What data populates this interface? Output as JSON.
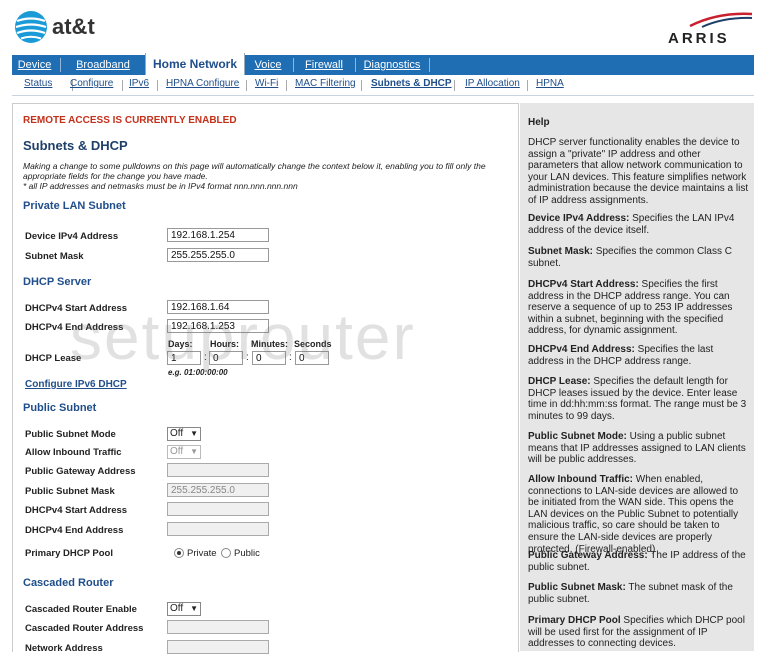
{
  "brand": {
    "att": "at&t",
    "arris": "ARRIS"
  },
  "nav": {
    "tabs": [
      "Device",
      "Broadband",
      "Home Network",
      "Voice",
      "Firewall",
      "Diagnostics"
    ],
    "active": "Home Network"
  },
  "subnav": {
    "items": [
      "Status",
      "Configure",
      "IPv6",
      "HPNA Configure",
      "Wi-Fi",
      "MAC Filtering",
      "Subnets & DHCP",
      "IP Allocation",
      "HPNA"
    ],
    "active": "Subnets & DHCP"
  },
  "main": {
    "remote_notice": "REMOTE ACCESS IS CURRENTLY ENABLED",
    "title": "Subnets & DHCP",
    "intro1": "Making a change to some pulldowns on this page will automatically change the context below it, enabling you to fill only the appropriate fields for the change you have made.",
    "intro2": "* all IP addresses and netmasks must be in IPv4 format nnn.nnn.nnn.nnn",
    "private_lan": {
      "heading": "Private LAN Subnet",
      "device_ipv4_label": "Device IPv4 Address",
      "device_ipv4_value": "192.168.1.254",
      "subnet_mask_label": "Subnet Mask",
      "subnet_mask_value": "255.255.255.0"
    },
    "dhcp": {
      "heading": "DHCP Server",
      "start_label": "DHCPv4 Start Address",
      "start_value": "192.168.1.64",
      "end_label": "DHCPv4 End Address",
      "end_value": "192.168.1.253",
      "lease_label": "DHCP Lease",
      "days_label": "Days:",
      "hours_label": "Hours:",
      "minutes_label": "Minutes:",
      "seconds_label": "Seconds",
      "days": "1",
      "hours": "0",
      "minutes": "0",
      "seconds": "0",
      "example": "e.g. 01:00:00:00",
      "ipv6_link": "Configure IPv6 DHCP"
    },
    "public_subnet": {
      "heading": "Public Subnet",
      "mode_label": "Public Subnet Mode",
      "mode_value": "Off",
      "inbound_label": "Allow Inbound Traffic",
      "inbound_value": "Off",
      "gateway_label": "Public Gateway Address",
      "mask_label": "Public Subnet Mask",
      "mask_value": "255.255.255.0",
      "start_label": "DHCPv4 Start Address",
      "end_label": "DHCPv4 End Address",
      "pool_label": "Primary DHCP Pool",
      "pool_private": "Private",
      "pool_public": "Public"
    },
    "cascaded": {
      "heading": "Cascaded Router",
      "enable_label": "Cascaded Router Enable",
      "enable_value": "Off",
      "address_label": "Cascaded Router Address",
      "network_label": "Network Address"
    }
  },
  "help": {
    "title": "Help",
    "p1": "DHCP server functionality enables the device to assign a \"private\" IP address and other parameters that allow network communication to your LAN devices. This feature simplifies network administration because the device maintains a list of IP address assignments.",
    "items": [
      {
        "term": "Device IPv4 Address:",
        "text": " Specifies the LAN IPv4 address of the device itself."
      },
      {
        "term": "Subnet Mask:",
        "text": " Specifies the common Class C subnet."
      },
      {
        "term": "DHCPv4 Start Address:",
        "text": " Specifies the first address in the DHCP address range. You can reserve a sequence of up to 253 IP addresses within a subnet, beginning with the specified address, for dynamic assignment."
      },
      {
        "term": "DHCPv4 End Address:",
        "text": " Specifies the last address in the DHCP address range."
      },
      {
        "term": "DHCP Lease:",
        "text": " Specifies the default length for DHCP leases issued by the device. Enter lease time in dd:hh:mm:ss format. The range must be 3 minutes to 99 days."
      },
      {
        "term": "Public Subnet Mode:",
        "text": " Using a public subnet means that IP addresses assigned to LAN clients will be public addresses."
      },
      {
        "term": "Allow Inbound Traffic:",
        "text": " When enabled, connections to LAN-side devices are allowed to be initiated from the WAN side. This opens the LAN devices on the Public Subnet to potentially malicious traffic, so care should be taken to ensure the LAN-side devices are properly protected. (Firewall-enabled)"
      },
      {
        "term": "Public Gateway Address:",
        "text": " The IP address of the public subnet."
      },
      {
        "term": "Public Subnet Mask:",
        "text": " The subnet mask of the public subnet."
      },
      {
        "term": "Primary DHCP Pool",
        "text": " Specifies which DHCP pool will be used first for the assignment of IP addresses to connecting devices."
      }
    ]
  },
  "watermark": "setuprouter",
  "colors": {
    "nav": "#1f6db3",
    "heading": "#1f4e8a",
    "alert": "#c3311b",
    "help_bg": "#e6e6e6"
  }
}
